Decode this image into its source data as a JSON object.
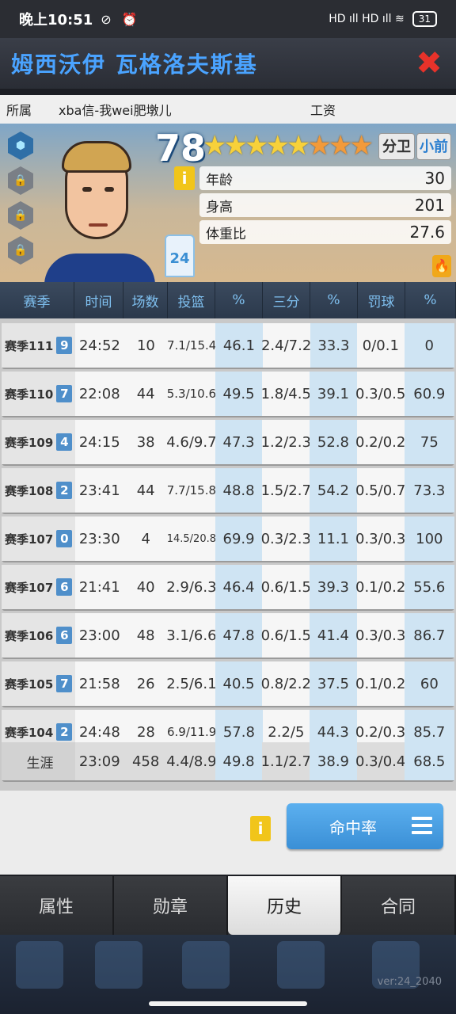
{
  "status": {
    "time": "晚上10:51",
    "icons": "⊘ ⏰",
    "network": "HD ıll HD ıll ≋",
    "battery": "31"
  },
  "title": {
    "player_name": "姆西沃伊 瓦格洛夫斯基",
    "close": "✖"
  },
  "info": {
    "team_label": "所属",
    "team_value": "xba信-我wei肥墩儿",
    "salary_label": "工资"
  },
  "player": {
    "overall": "78",
    "stars_gold": "★★★★★",
    "stars_orange": "★★★",
    "position1": "分卫",
    "position2": "小前",
    "jersey_number": "24",
    "info_symbol": "i",
    "fire_symbol": "🔥",
    "attributes": [
      {
        "label": "年龄",
        "value": "30"
      },
      {
        "label": "身高",
        "value": "201"
      },
      {
        "label": "体重比",
        "value": "27.6"
      }
    ],
    "badges": [
      "⬢",
      "🔒",
      "🔒",
      "🔒"
    ]
  },
  "table": {
    "headers": [
      "赛季",
      "时间",
      "场数",
      "投篮",
      "%",
      "三分",
      "%",
      "罚球",
      "%"
    ],
    "rows": [
      {
        "season": "赛季111",
        "level": "9",
        "time": "24:52",
        "games": "10",
        "fg": "7.1/15.4",
        "fgp": "46.1",
        "tp": "2.4/7.2",
        "tpp": "33.3",
        "ft": "0/0.1",
        "ftp": "0"
      },
      {
        "season": "赛季110",
        "level": "7",
        "time": "22:08",
        "games": "44",
        "fg": "5.3/10.6",
        "fgp": "49.5",
        "tp": "1.8/4.5",
        "tpp": "39.1",
        "ft": "0.3/0.5",
        "ftp": "60.9"
      },
      {
        "season": "赛季109",
        "level": "4",
        "time": "24:15",
        "games": "38",
        "fg": "4.6/9.7",
        "fgp": "47.3",
        "tp": "1.2/2.3",
        "tpp": "52.8",
        "ft": "0.2/0.2",
        "ftp": "75"
      },
      {
        "season": "赛季108",
        "level": "2",
        "time": "23:41",
        "games": "44",
        "fg": "7.7/15.8",
        "fgp": "48.8",
        "tp": "1.5/2.7",
        "tpp": "54.2",
        "ft": "0.5/0.7",
        "ftp": "73.3"
      },
      {
        "season": "赛季107",
        "level": "0",
        "time": "23:30",
        "games": "4",
        "fg": "14.5/20.8",
        "fgp": "69.9",
        "tp": "0.3/2.3",
        "tpp": "11.1",
        "ft": "0.3/0.3",
        "ftp": "100"
      },
      {
        "season": "赛季107",
        "level": "6",
        "time": "21:41",
        "games": "40",
        "fg": "2.9/6.3",
        "fgp": "46.4",
        "tp": "0.6/1.5",
        "tpp": "39.3",
        "ft": "0.1/0.2",
        "ftp": "55.6"
      },
      {
        "season": "赛季106",
        "level": "6",
        "time": "23:00",
        "games": "48",
        "fg": "3.1/6.6",
        "fgp": "47.8",
        "tp": "0.6/1.5",
        "tpp": "41.4",
        "ft": "0.3/0.3",
        "ftp": "86.7"
      },
      {
        "season": "赛季105",
        "level": "7",
        "time": "21:58",
        "games": "26",
        "fg": "2.5/6.1",
        "fgp": "40.5",
        "tp": "0.8/2.2",
        "tpp": "37.5",
        "ft": "0.1/0.2",
        "ftp": "60"
      },
      {
        "season": "赛季104",
        "level": "2",
        "time": "24:48",
        "games": "28",
        "fg": "6.9/11.9",
        "fgp": "57.8",
        "tp": "2.2/5",
        "tpp": "44.3",
        "ft": "0.2/0.3",
        "ftp": "85.7"
      }
    ],
    "career": {
      "label": "生涯",
      "time": "23:09",
      "games": "458",
      "fg": "4.4/8.9",
      "fgp": "49.8",
      "tp": "1.1/2.7",
      "tpp": "38.9",
      "ft": "0.3/0.4",
      "ftp": "68.5"
    }
  },
  "actions": {
    "info_symbol": "i",
    "sort_label": "命中率"
  },
  "tabs": [
    {
      "label": "属性",
      "active": false
    },
    {
      "label": "勋章",
      "active": false
    },
    {
      "label": "历史",
      "active": true
    },
    {
      "label": "合同",
      "active": false
    }
  ],
  "footer": {
    "version": "ver:24_2040"
  },
  "colors": {
    "accent_blue": "#4aa3ff",
    "close_red": "#e8322a",
    "highlight_cell": "#cfe4f3",
    "button_blue": "#3a8fd6",
    "info_yellow": "#f1c51a"
  }
}
